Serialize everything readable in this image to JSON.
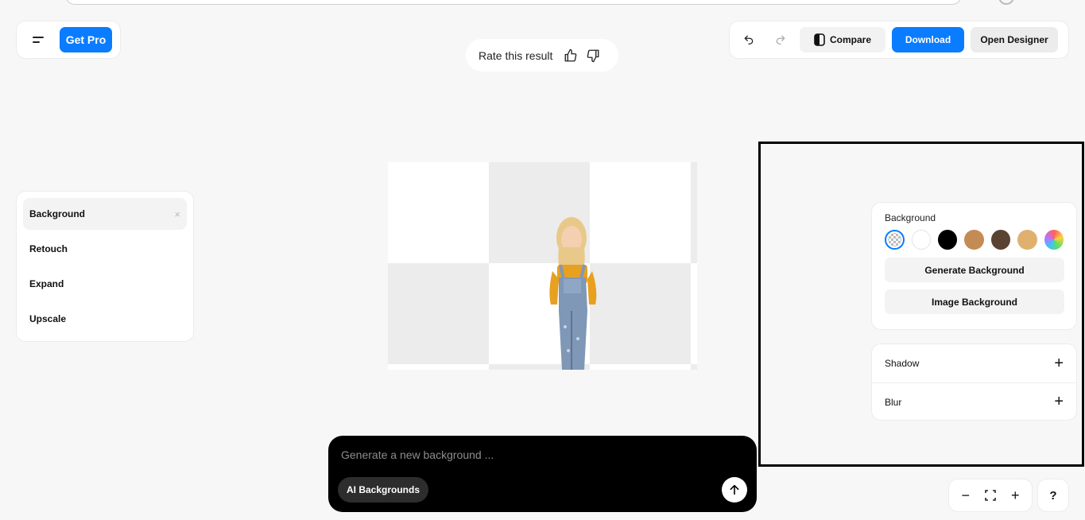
{
  "top_left": {
    "get_pro_label": "Get Pro"
  },
  "rating": {
    "label": "Rate this result"
  },
  "toolbar": {
    "compare_label": "Compare",
    "download_label": "Download",
    "open_designer_label": "Open Designer"
  },
  "left_panel": {
    "items": [
      {
        "label": "Background",
        "active": true
      },
      {
        "label": "Retouch"
      },
      {
        "label": "Expand"
      },
      {
        "label": "Upscale"
      }
    ],
    "close_glyph": "×"
  },
  "background_panel": {
    "title": "Background",
    "swatches": [
      "transparent",
      "#ffffff",
      "#000000",
      "#c58b55",
      "#5b4332",
      "#e0b06e",
      "rainbow"
    ],
    "generate_label": "Generate Background",
    "image_label": "Image Background"
  },
  "effects": {
    "shadow_label": "Shadow",
    "blur_label": "Blur",
    "plus_glyph": "+"
  },
  "prompt": {
    "placeholder": "Generate a new background ...",
    "chip_label": "AI Backgrounds"
  },
  "zoom": {
    "minus": "−",
    "plus": "+"
  },
  "help": {
    "label": "?"
  },
  "colors": {
    "accent": "#0a7cff"
  }
}
